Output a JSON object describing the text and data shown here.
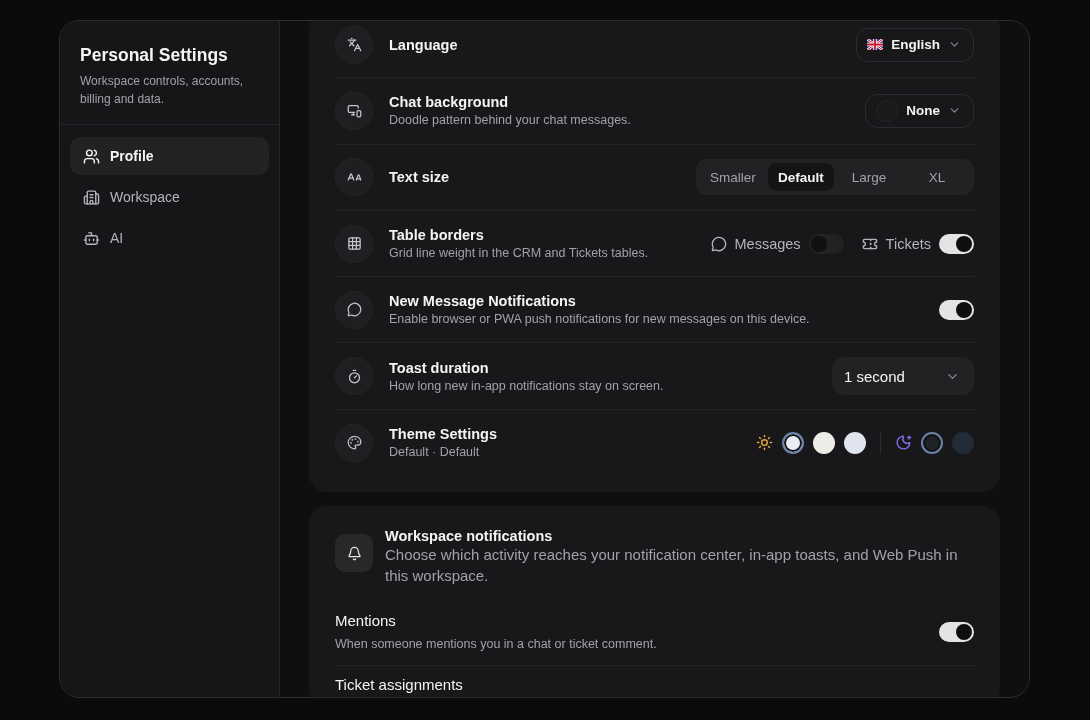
{
  "sidebar": {
    "title": "Personal Settings",
    "subtitle": "Workspace controls, accounts, billing and data.",
    "items": [
      {
        "label": "Profile",
        "selected": true
      },
      {
        "label": "Workspace",
        "selected": false
      },
      {
        "label": "AI",
        "selected": false
      }
    ]
  },
  "preferences": {
    "rows": [
      {
        "kind": "select",
        "title": "Language",
        "select": {
          "value": "English"
        }
      },
      {
        "kind": "select",
        "title": "Chat background",
        "description": "Doodle pattern behind your chat messages.",
        "select": {
          "value": "None"
        }
      },
      {
        "kind": "segmented",
        "title": "Text size",
        "options": [
          {
            "label": "Smaller",
            "selected": false
          },
          {
            "label": "Default",
            "selected": true
          },
          {
            "label": "Large",
            "selected": false
          },
          {
            "label": "XL",
            "selected": false
          }
        ]
      },
      {
        "kind": "toggles",
        "title": "Table borders",
        "description": "Grid line weight in the CRM and Tickets tables.",
        "toggles": [
          {
            "label": "Messages",
            "on": false
          },
          {
            "label": "Tickets",
            "on": true
          }
        ]
      },
      {
        "kind": "toggle",
        "title": "New Message Notifications",
        "description": "Enable browser or PWA push notifications for new messages on this device.",
        "on": true
      },
      {
        "kind": "select",
        "title": "Toast duration",
        "description": "How long new in-app notifications stay on screen.",
        "select": {
          "value": "1 second"
        }
      },
      {
        "kind": "swatches",
        "title": "Theme Settings",
        "description": "Default · Default",
        "light": [
          {
            "color": "#e9eef6",
            "selected": true
          },
          {
            "color": "#eeece7",
            "selected": false
          },
          {
            "color": "#dfe4ee",
            "selected": false
          }
        ],
        "dark": [
          {
            "color": "#1f2226",
            "selected": true
          },
          {
            "color": "#222c38",
            "selected": false
          }
        ]
      }
    ]
  },
  "notifications": {
    "title": "Workspace notifications",
    "description": "Choose which activity reaches your notification center, in-app toasts, and Web Push in this workspace.",
    "items": [
      {
        "title": "Mentions",
        "description": "When someone mentions you in a chat or ticket comment.",
        "on": true
      },
      {
        "title": "Ticket assignments"
      }
    ]
  }
}
